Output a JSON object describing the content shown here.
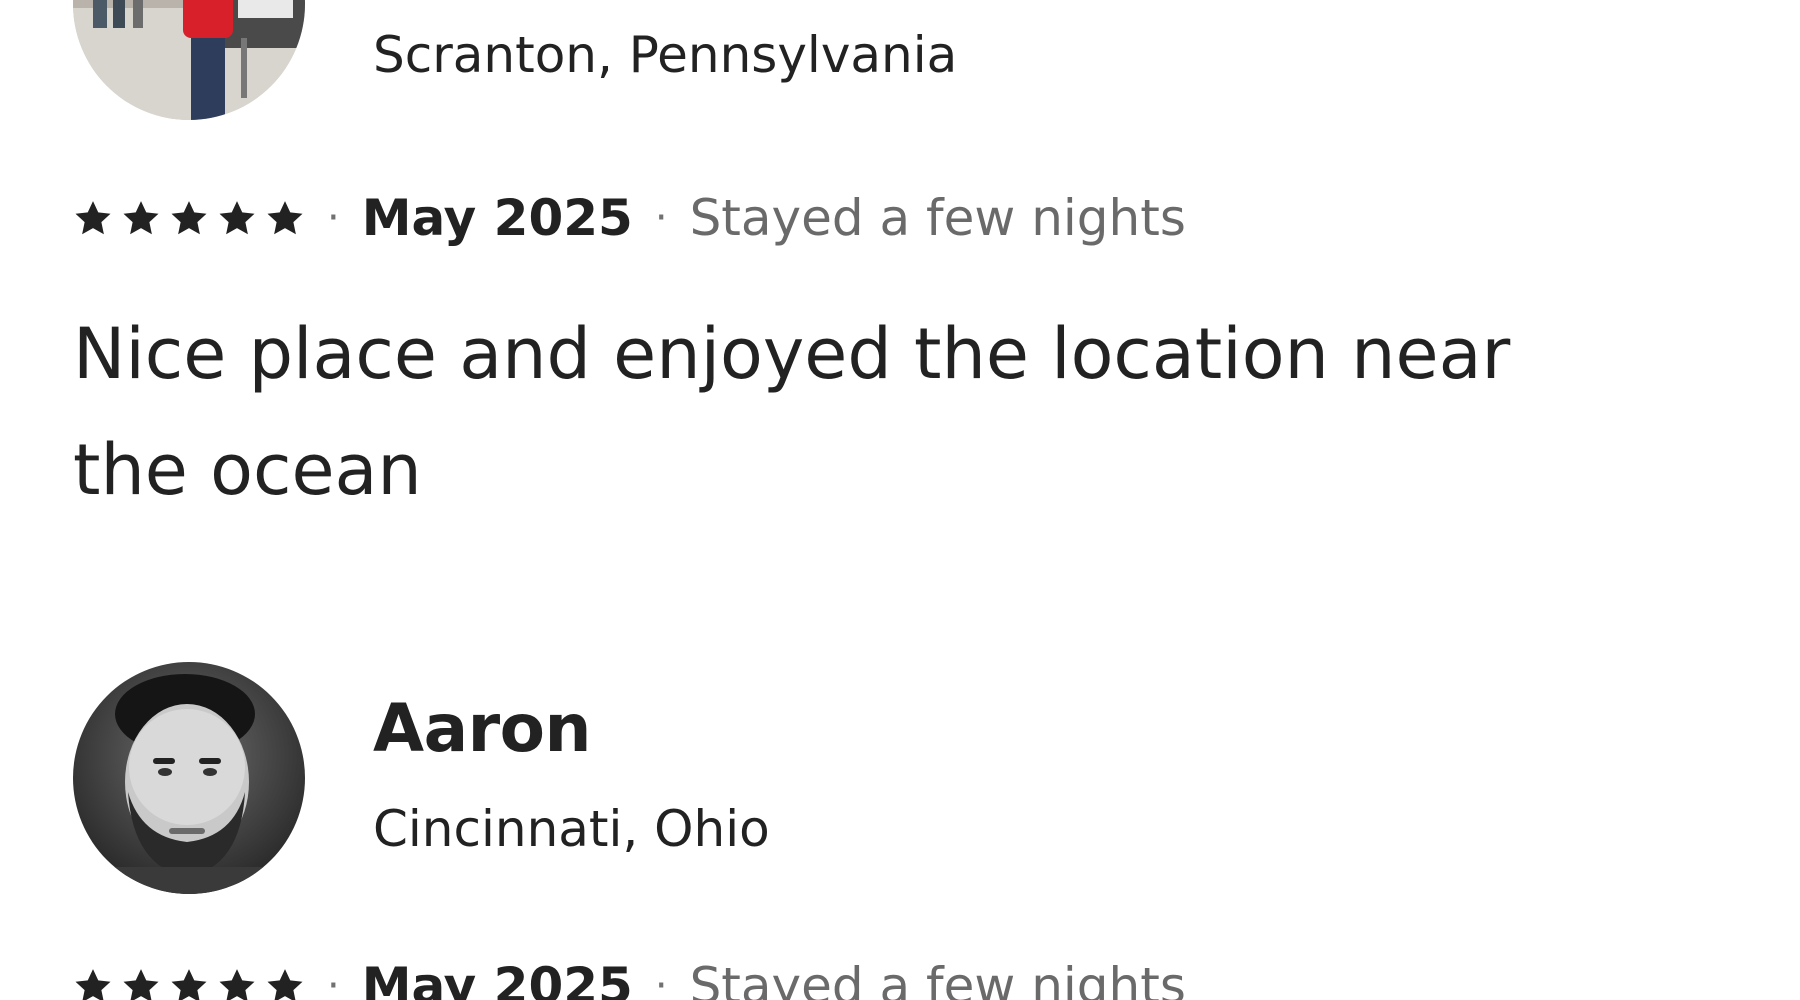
{
  "reviews": [
    {
      "name": "",
      "location": "Scranton, Pennsylvania",
      "rating": 5,
      "date": "May 2025",
      "stay": "Stayed a few nights",
      "text": "Nice place and enjoyed the location near the ocean"
    },
    {
      "name": "Aaron",
      "location": "Cincinnati, Ohio",
      "rating": 5,
      "date": "May 2025",
      "stay": "Stayed a few nights",
      "text": ""
    }
  ],
  "separator": "·",
  "icons": {
    "star": "star-icon",
    "avatar_1": "avatar-photo",
    "avatar_2": "avatar-photo"
  },
  "colors": {
    "text_primary": "#222222",
    "text_secondary": "#6a6a6a",
    "star": "#222222",
    "background": "#ffffff"
  }
}
